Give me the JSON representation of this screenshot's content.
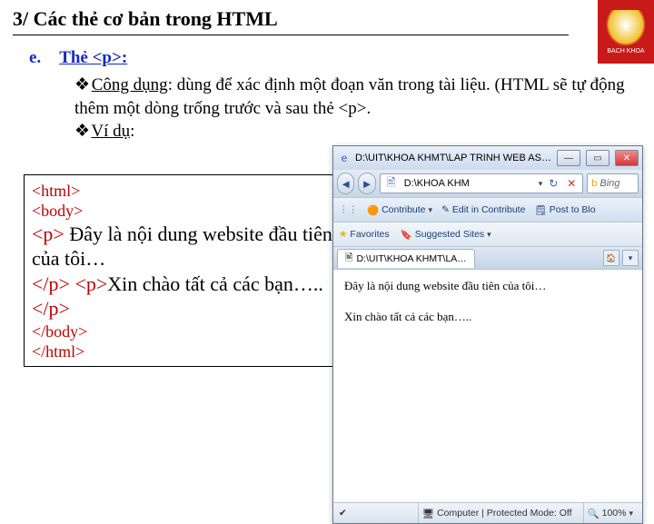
{
  "title": "3/ Các thẻ cơ bản trong HTML",
  "logo_label": "BACH KHOA",
  "section": {
    "letter": "e.",
    "name": "Thẻ  <p>:"
  },
  "bullets": {
    "b1_label": "Công dụng",
    "b1_text": ": dùng để xác định một đoạn văn trong tài liệu. (HTML sẽ tự động thêm một dòng trống trước và sau thẻ <p>.",
    "b2_label": "Ví dụ",
    "b2_suffix": ":"
  },
  "code": {
    "l1": "<html>",
    "l2": "<body>",
    "p_open": "<p>",
    "line_a": " Đây là nội dung website đầu tiên của tôi…",
    "p_close": "</p>",
    "p_open2": "<p>",
    "line_b": "Xin chào tất cả các bạn….. ",
    "p_close2": "</p>",
    "l3": "</body>",
    "l4": "</html>"
  },
  "browser": {
    "window_title": "D:\\UIT\\KHOA KHMT\\LAP TRINH WEB ASP\\TH…",
    "address": "D:\\KHOA KHM",
    "search_placeholder": "Bing",
    "toolbar": {
      "contribute": "Contribute",
      "edit": "Edit in Contribute",
      "post": "Post to Blo"
    },
    "fav": {
      "favorites": "Favorites",
      "suggested": "Suggested Sites"
    },
    "tab": "D:\\UIT\\KHOA KHMT\\LA…",
    "content": {
      "p1": "Đây là nội dung website đầu tiên của tôi…",
      "p2": "Xin chào tất cả các bạn….."
    },
    "status": {
      "mode": "Computer | Protected Mode: Off",
      "zoom": "100%"
    }
  }
}
